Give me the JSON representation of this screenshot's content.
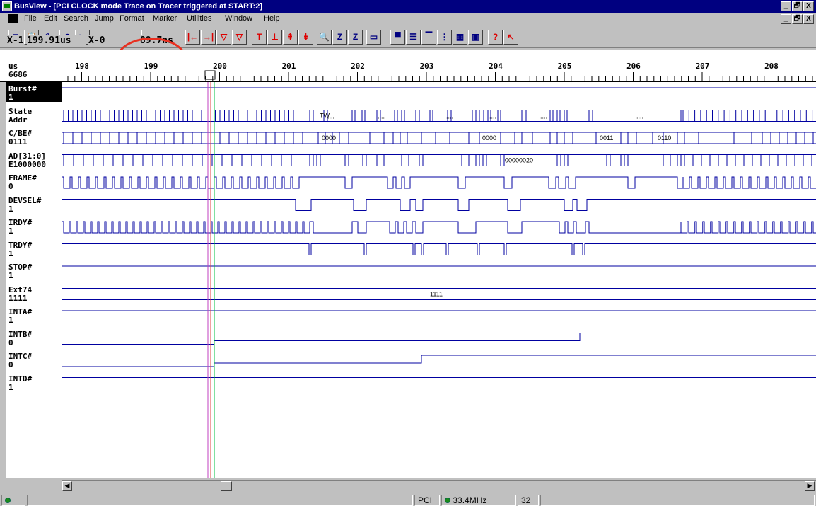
{
  "window": {
    "app_name": "BusView",
    "title": "BusView - [PCI CLOCK mode Trace on Tracer triggered at START:2]",
    "caption_buttons": [
      "_",
      "🗗",
      "X"
    ],
    "doc_buttons": [
      "_",
      "🗗",
      "X"
    ]
  },
  "menu": [
    "File",
    "Edit",
    "Search",
    "Jump",
    "Format",
    "Marker",
    "Utilities",
    "Window",
    "Help"
  ],
  "toolbar": {
    "x1_label": "X-1",
    "x1_value": "199.91us",
    "x2_label": "X-0",
    "x2_value": "89.7ns",
    "buttons": [
      "copy-icon",
      "paste-icon",
      "print-icon",
      "undo-icon",
      "cut-icon",
      "zoom-icon",
      "goto-start-icon",
      "goto-end-icon",
      "marker-x-icon",
      "marker-o-icon",
      "trigger-t-icon",
      "trigger-down-icon",
      "edge-up-icon",
      "edge-down-icon",
      "search-icon",
      "zoom-z-icon",
      "zoom-z2-icon",
      "fit-icon",
      "window1-icon",
      "window2-icon",
      "window3-icon",
      "window4-icon",
      "window5-icon",
      "window6-icon",
      "help-icon",
      "pointer-help-icon"
    ],
    "accent_color": "#e83020"
  },
  "ruler": {
    "unit": "us",
    "count": "6686",
    "ticks": [
      "198",
      "199",
      "200",
      "201",
      "202",
      "203",
      "204",
      "205",
      "206",
      "207",
      "208"
    ]
  },
  "signals": [
    {
      "name": "Burst#",
      "value": "1"
    },
    {
      "name": "State",
      "value": "Addr"
    },
    {
      "name": "C/BE#",
      "value": "0111"
    },
    {
      "name": "AD[31:0]",
      "value": "E1000000"
    },
    {
      "name": "FRAME#",
      "value": "0"
    },
    {
      "name": "DEVSEL#",
      "value": "1"
    },
    {
      "name": "IRDY#",
      "value": "1"
    },
    {
      "name": "TRDY#",
      "value": "1"
    },
    {
      "name": "STOP#",
      "value": "1"
    },
    {
      "name": "Ext74",
      "value": "1111"
    },
    {
      "name": "INTA#",
      "value": "1"
    },
    {
      "name": "INTB#",
      "value": "0"
    },
    {
      "name": "INTC#",
      "value": "0"
    },
    {
      "name": "INTD#",
      "value": "1"
    }
  ],
  "bus_annotations": {
    "state": [
      "TW",
      "....",
      "....",
      "....",
      "....",
      "....",
      "...."
    ],
    "cbe": [
      "0000",
      "0000",
      "0011",
      "0110"
    ],
    "ad": [
      "00000020"
    ],
    "ext74": "1111"
  },
  "status": {
    "bus": "PCI",
    "clock": "33.4MHz",
    "width": "32"
  },
  "colors": {
    "signal": "#0000a0",
    "marker_red": "#e04040",
    "marker_green": "#00c040",
    "marker_magenta": "#c040c0"
  }
}
